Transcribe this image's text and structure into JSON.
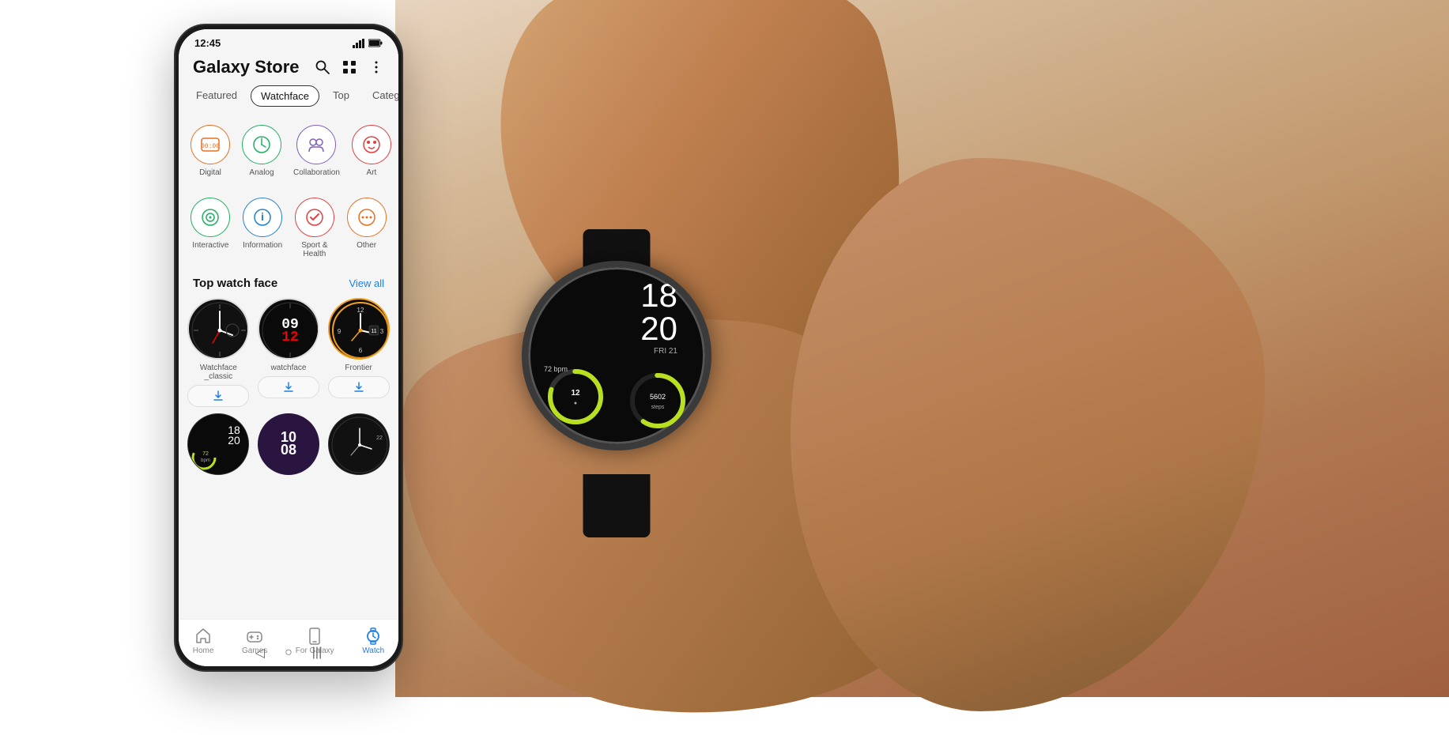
{
  "background": {
    "color": "#f0e8e0"
  },
  "phone": {
    "status": {
      "time": "12:45",
      "signal_icon": "📶",
      "battery_icon": "🔋"
    },
    "header": {
      "title": "Galaxy Store",
      "search_icon": "search",
      "apps_icon": "apps",
      "more_icon": "more"
    },
    "nav_tabs": [
      {
        "label": "Featured",
        "active": false
      },
      {
        "label": "Watchface",
        "active": true
      },
      {
        "label": "Top",
        "active": false
      },
      {
        "label": "Category",
        "active": false
      }
    ],
    "categories_row1": [
      {
        "label": "Digital",
        "icon": "⏱",
        "color": "#e87020"
      },
      {
        "label": "Analog",
        "icon": "🕐",
        "color": "#20b060"
      },
      {
        "label": "Collaboration",
        "icon": "👥",
        "color": "#8060c0"
      },
      {
        "label": "Art",
        "icon": "🎨",
        "color": "#e04040"
      }
    ],
    "categories_row2": [
      {
        "label": "Interactive",
        "icon": "🎯",
        "color": "#20b060"
      },
      {
        "label": "Information",
        "icon": "ℹ",
        "color": "#2080d0"
      },
      {
        "label": "Sport & Health",
        "icon": "⚡",
        "color": "#e04040"
      },
      {
        "label": "Other",
        "icon": "···",
        "color": "#e87020"
      }
    ],
    "top_watch_face": {
      "section_title": "Top watch face",
      "view_all": "View all",
      "items": [
        {
          "label": "Watchface\n_classic",
          "style": "dark-analog"
        },
        {
          "label": "watchface",
          "style": "dark-digital-red"
        },
        {
          "label": "Frontier",
          "style": "dark-frontier",
          "highlighted": true
        }
      ]
    },
    "bottom_nav": [
      {
        "label": "Home",
        "icon": "🏠",
        "active": false
      },
      {
        "label": "Games",
        "icon": "🎮",
        "active": false
      },
      {
        "label": "For Galaxy",
        "icon": "📱",
        "active": false
      },
      {
        "label": "Watch",
        "icon": "⌚",
        "active": true
      }
    ]
  },
  "watch": {
    "time": {
      "hour": "18",
      "minute": "20"
    },
    "date": "FRI 21",
    "heart_rate": "72 bpm",
    "steps": "5602"
  }
}
